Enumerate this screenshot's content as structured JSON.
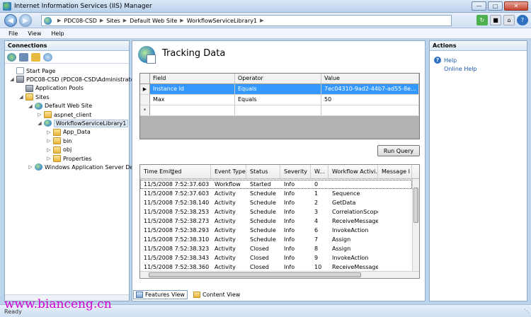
{
  "window": {
    "title": "Internet Information Services (IIS) Manager"
  },
  "address": {
    "crumbs": [
      "PDC08-CSD",
      "Sites",
      "Default Web Site",
      "WorkflowServiceLibrary1"
    ]
  },
  "menu": [
    "File",
    "View",
    "Help"
  ],
  "connections": {
    "title": "Connections",
    "tree": [
      {
        "label": "Start Page",
        "icon": "page-icon",
        "level": 0,
        "expander": ""
      },
      {
        "label": "PDC08-CSD (PDC08-CSD\\Administrator",
        "icon": "server-icon",
        "level": 0,
        "expander": "◢"
      },
      {
        "label": "Application Pools",
        "icon": "app-pools-icon",
        "level": 1,
        "expander": ""
      },
      {
        "label": "Sites",
        "icon": "folder-icon",
        "level": 1,
        "expander": "◢"
      },
      {
        "label": "Default Web Site",
        "icon": "globe-icon",
        "level": 2,
        "expander": "◢"
      },
      {
        "label": "aspnet_client",
        "icon": "folder-icon",
        "level": 3,
        "expander": "▷"
      },
      {
        "label": "WorkflowServiceLibrary1",
        "icon": "globe-icon",
        "level": 3,
        "expander": "◢",
        "selected": true
      },
      {
        "label": "App_Data",
        "icon": "folder-icon",
        "level": 4,
        "expander": "▷"
      },
      {
        "label": "bin",
        "icon": "folder-icon",
        "level": 4,
        "expander": "▷"
      },
      {
        "label": "obj",
        "icon": "folder-icon",
        "level": 4,
        "expander": "▷"
      },
      {
        "label": "Properties",
        "icon": "folder-icon",
        "level": 4,
        "expander": "▷"
      },
      {
        "label": "Windows Application Server Defa",
        "icon": "globe-icon",
        "level": 2,
        "expander": "▷"
      }
    ]
  },
  "main": {
    "title": "Tracking Data",
    "query": {
      "headers": [
        "Field",
        "Operator",
        "Value"
      ],
      "rows": [
        {
          "marker": "▶",
          "field": "Instance Id",
          "operator": "Equals",
          "value": "7ec04310-9ad2-44b7-ad55-8e...",
          "selected": true
        },
        {
          "marker": "",
          "field": "Max",
          "operator": "Equals",
          "value": "50"
        },
        {
          "marker": "*",
          "field": "",
          "operator": "",
          "value": ""
        }
      ]
    },
    "run_label": "Run Query",
    "results": {
      "headers": [
        "Time Emitted",
        "Event Type",
        "Status",
        "Severity",
        "W...",
        "Workflow Activi...",
        "Message I"
      ],
      "rows": [
        [
          "11/5/2008 7:52:37.603 PM",
          "Workflow",
          "Started",
          "Info",
          "0",
          ""
        ],
        [
          "11/5/2008 7:52:37.603 PM",
          "Activity",
          "Schedule",
          "Info",
          "1",
          "Sequence"
        ],
        [
          "11/5/2008 7:52:38.140 PM",
          "Activity",
          "Schedule",
          "Info",
          "2",
          "GetData"
        ],
        [
          "11/5/2008 7:52:38.253 PM",
          "Activity",
          "Schedule",
          "Info",
          "3",
          "CorrelationScope"
        ],
        [
          "11/5/2008 7:52:38.273 PM",
          "Activity",
          "Schedule",
          "Info",
          "4",
          "ReceiveMessage"
        ],
        [
          "11/5/2008 7:52:38.293 PM",
          "Activity",
          "Schedule",
          "Info",
          "6",
          "InvokeAction"
        ],
        [
          "11/5/2008 7:52:38.310 PM",
          "Activity",
          "Schedule",
          "Info",
          "7",
          "Assign"
        ],
        [
          "11/5/2008 7:52:38.323 PM",
          "Activity",
          "Closed",
          "Info",
          "8",
          "Assign"
        ],
        [
          "11/5/2008 7:52:38.343 PM",
          "Activity",
          "Closed",
          "Info",
          "9",
          "InvokeAction"
        ],
        [
          "11/5/2008 7:52:38.360 PM",
          "Activity",
          "Closed",
          "Info",
          "10",
          "ReceiveMessage"
        ]
      ]
    }
  },
  "views": {
    "features": "Features View",
    "content": "Content View"
  },
  "actions": {
    "title": "Actions",
    "help": "Help",
    "online_help": "Online Help"
  },
  "status": "Ready",
  "watermark": "www.bianceng.cn"
}
